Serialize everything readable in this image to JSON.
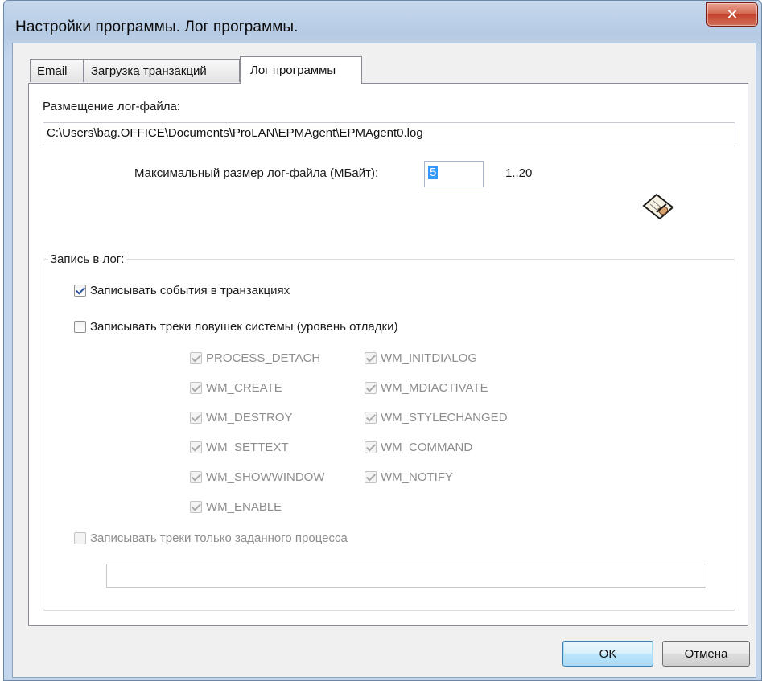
{
  "window": {
    "title": "Настройки программы. Лог программы.",
    "close_glyph": "✕"
  },
  "tabs": [
    {
      "label": "Email",
      "active": false
    },
    {
      "label": "Загрузка транзакций",
      "active": false
    },
    {
      "label": "Лог программы",
      "active": true
    }
  ],
  "log_file": {
    "location_label": "Размещение лог-файла:",
    "path": "C:\\Users\\bag.OFFICE\\Documents\\ProLAN\\EPMAgent\\EPMAgent0.log",
    "max_size_label": "Максимальный размер лог-файла (МБайт):",
    "max_size_value": "5",
    "max_size_range": "1..20"
  },
  "logging": {
    "group_label": "Запись в лог:",
    "write_transactions": {
      "label": "Записывать события в транзакциях",
      "checked": true
    },
    "write_hook_traces": {
      "label": "Записывать треки ловушек системы (уровень отладки)",
      "checked": false
    },
    "hooks_left": [
      {
        "label": "PROCESS_DETACH",
        "checked": true
      },
      {
        "label": "WM_CREATE",
        "checked": true
      },
      {
        "label": "WM_DESTROY",
        "checked": true
      },
      {
        "label": "WM_SETTEXT",
        "checked": true
      },
      {
        "label": "WM_SHOWWINDOW",
        "checked": true
      },
      {
        "label": "WM_ENABLE",
        "checked": true
      }
    ],
    "hooks_right": [
      {
        "label": "WM_INITDIALOG",
        "checked": true
      },
      {
        "label": "WM_MDIACTIVATE",
        "checked": true
      },
      {
        "label": "WM_STYLECHANGED",
        "checked": true
      },
      {
        "label": "WM_COMMAND",
        "checked": true
      },
      {
        "label": "WM_NOTIFY",
        "checked": true
      }
    ],
    "only_process": {
      "label": "Записывать треки только заданного процесса",
      "checked": false
    },
    "process_name_value": ""
  },
  "buttons": {
    "ok": "OK",
    "cancel": "Отмена"
  },
  "colors": {
    "selection": "#3399ff",
    "close_button": "#c2422b",
    "checkmark": "#2c4f9a"
  }
}
